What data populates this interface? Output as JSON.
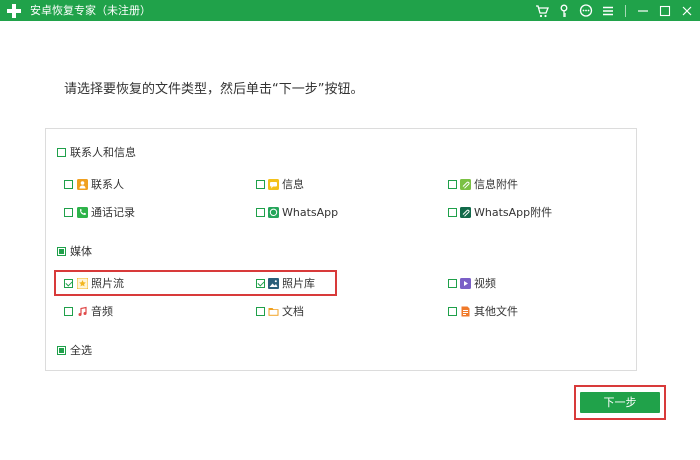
{
  "titlebar": {
    "title": "安卓恢复专家（未注册）",
    "icons": [
      "cart-icon",
      "key-icon",
      "chat-icon",
      "menu-icon",
      "minimize-icon",
      "maximize-icon",
      "close-icon"
    ]
  },
  "instruction": "请选择要恢复的文件类型，然后单击“下一步”按钮。",
  "groups": {
    "contacts": {
      "label": "联系人和信息",
      "state": "unchecked",
      "items": [
        {
          "label": "联系人",
          "icon": "contacts-icon",
          "color": "#f0a020",
          "checked": false
        },
        {
          "label": "信息",
          "icon": "messages-icon",
          "color": "#f3c11b",
          "checked": false
        },
        {
          "label": "信息附件",
          "icon": "attachment-icon",
          "color": "#7ac143",
          "checked": false
        },
        {
          "label": "通话记录",
          "icon": "call-log-icon",
          "color": "#2eb34a",
          "checked": false
        },
        {
          "label": "WhatsApp",
          "icon": "whatsapp-icon",
          "color": "#25a55a",
          "checked": false
        },
        {
          "label": "WhatsApp附件",
          "icon": "whatsapp-attachment-icon",
          "color": "#126a4a",
          "checked": false
        }
      ]
    },
    "media": {
      "label": "媒体",
      "state": "partial",
      "items": [
        {
          "label": "照片流",
          "icon": "photo-stream-icon",
          "color": "#f3b61f",
          "checked": true
        },
        {
          "label": "照片库",
          "icon": "photo-library-icon",
          "color": "#2a5f7a",
          "checked": true
        },
        {
          "label": "视频",
          "icon": "video-icon",
          "color": "#7a5fc7",
          "checked": false
        },
        {
          "label": "音频",
          "icon": "audio-icon",
          "color": "#e04a4a",
          "checked": false
        },
        {
          "label": "文档",
          "icon": "document-icon",
          "color": "#f0a020",
          "checked": false
        },
        {
          "label": "其他文件",
          "icon": "other-files-icon",
          "color": "#f07a2a",
          "checked": false
        }
      ]
    }
  },
  "select_all": {
    "label": "全选",
    "state": "partial"
  },
  "next_button": "下一步",
  "colors": {
    "brand": "#20a24a",
    "highlight": "#d83a3a"
  }
}
